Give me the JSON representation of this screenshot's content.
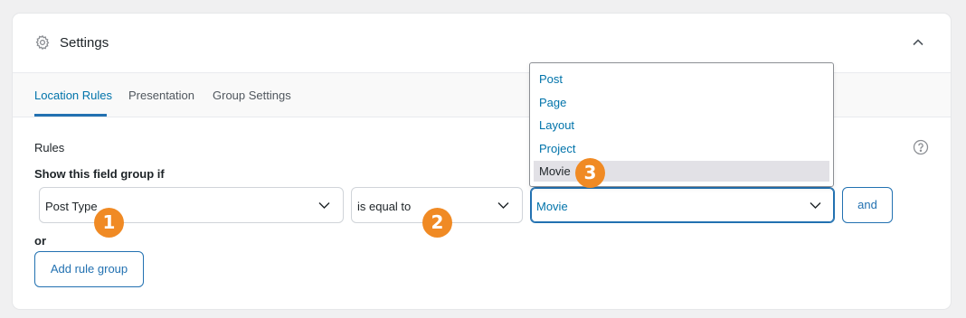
{
  "header": {
    "title": "Settings",
    "icon": "gear-icon",
    "collapse_icon": "chevron-up-icon"
  },
  "tabs": [
    {
      "label": "Location Rules",
      "active": true
    },
    {
      "label": "Presentation",
      "active": false
    },
    {
      "label": "Group Settings",
      "active": false
    }
  ],
  "rules": {
    "label": "Rules",
    "show_if": "Show this field group if",
    "param_select": "Post Type",
    "operator_select": "is equal to",
    "value_select": "Movie",
    "and_label": "and",
    "or_label": "or",
    "add_group_label": "Add rule group",
    "help_icon": "question-icon"
  },
  "dropdown": {
    "options": [
      {
        "label": "Post"
      },
      {
        "label": "Page"
      },
      {
        "label": "Layout"
      },
      {
        "label": "Project"
      },
      {
        "label": "Movie",
        "selected": true
      }
    ]
  },
  "badges": [
    "1",
    "2",
    "3"
  ],
  "colors": {
    "accent": "#2271b1",
    "link": "#0073aa",
    "badge": "#f08a24",
    "background": "#f0f0f1"
  }
}
